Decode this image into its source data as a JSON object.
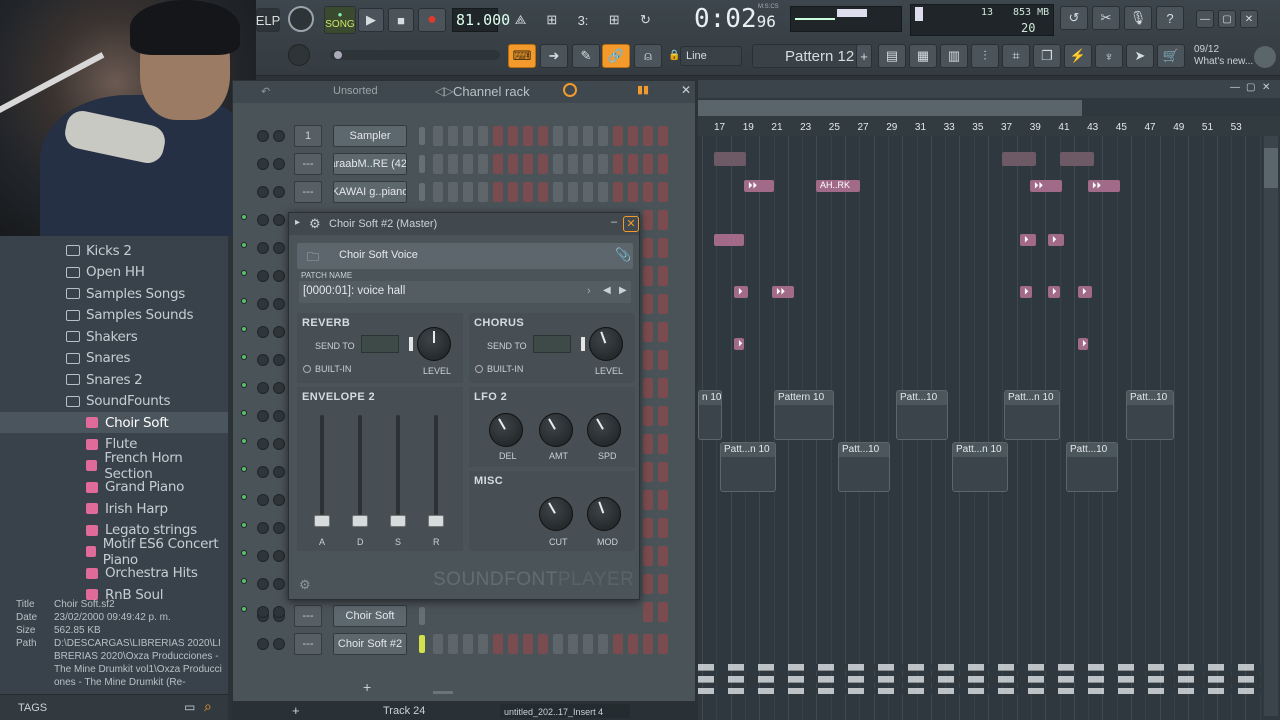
{
  "toolbar": {
    "elp": "ELP",
    "song": "SONG",
    "bpm": "81.000",
    "time": "0:02",
    "time_sub": "96",
    "time_unit": "M:S:CS",
    "cpu_num": "13",
    "mem": "853 MB",
    "voices": "20",
    "snap": "Line",
    "pattern": "Pattern 12",
    "news_date": "09/12",
    "news_text": "What's new..."
  },
  "rack": {
    "filter": "Unsorted",
    "title": "Channel rack",
    "channels": [
      {
        "num": "1",
        "name": "Sampler"
      },
      {
        "num": "---",
        "name": "araabM..RE (42)"
      },
      {
        "num": "---",
        "name": "KAWAI g..piano"
      },
      {
        "num": "---",
        "name": "Choir Soft"
      },
      {
        "num": "---",
        "name": "Choir Soft #2"
      }
    ],
    "add": "+"
  },
  "sfp": {
    "title": "Choir Soft #2 (Master)",
    "preset": "Choir Soft Voice",
    "patch_label": "PATCH NAME",
    "patch": "[0000:01]: voice hall",
    "reverb": "REVERB",
    "chorus": "CHORUS",
    "send_to": "SEND TO",
    "built_in": "BUILT-IN",
    "level": "LEVEL",
    "env": "ENVELOPE 2",
    "lfo": "LFO 2",
    "misc": "MISC",
    "env_labels": [
      "A",
      "D",
      "S",
      "R"
    ],
    "lfo_labels": [
      "DEL",
      "AMT",
      "SPD"
    ],
    "misc_labels": [
      "CUT",
      "MOD"
    ],
    "brand": "SOUNDFONT",
    "brand2": "PLAYER"
  },
  "browser": {
    "items": [
      {
        "label": "Kicks 2",
        "type": "folder",
        "indent": 0
      },
      {
        "label": "Open HH",
        "type": "folder",
        "indent": 0
      },
      {
        "label": "Samples Songs",
        "type": "folder",
        "indent": 0
      },
      {
        "label": "Samples Sounds",
        "type": "folder",
        "indent": 0
      },
      {
        "label": "Shakers",
        "type": "folder",
        "indent": 0
      },
      {
        "label": "Snares",
        "type": "folder",
        "indent": 0
      },
      {
        "label": "Snares 2",
        "type": "folder",
        "indent": 0
      },
      {
        "label": "SoundFounts",
        "type": "folder-open",
        "indent": 0
      },
      {
        "label": "Choir Soft",
        "type": "sf",
        "indent": 1
      },
      {
        "label": "Flute",
        "type": "sf",
        "indent": 1
      },
      {
        "label": "French Horn Section",
        "type": "sf",
        "indent": 1
      },
      {
        "label": "Grand Piano",
        "type": "sf",
        "indent": 1
      },
      {
        "label": "Irish Harp",
        "type": "sf",
        "indent": 1
      },
      {
        "label": "Legato strings",
        "type": "sf",
        "indent": 1
      },
      {
        "label": "Motif ES6 Concert Piano",
        "type": "sf",
        "indent": 1
      },
      {
        "label": "Orchestra Hits",
        "type": "sf",
        "indent": 1
      },
      {
        "label": "RnB Soul",
        "type": "sf",
        "indent": 1
      }
    ],
    "info": {
      "title_k": "Title",
      "title_v": "Choir Soft.sf2",
      "date_k": "Date",
      "date_v": "23/02/2000 09:49:42 p. m.",
      "size_k": "Size",
      "size_v": "562.85 KB",
      "path_k": "Path",
      "path_v": "D:\\DESCARGAS\\LIBRERIAS 2020\\LIBRERIAS 2020\\Oxza Producciones - The Mine Drumkit vol1\\Oxza Producciones - The Mine Drumkit (Re-"
    },
    "tags": "TAGS"
  },
  "playlist": {
    "ruler": [
      "17",
      "19",
      "21",
      "23",
      "25",
      "27",
      "29",
      "31",
      "33",
      "35",
      "37",
      "39",
      "41",
      "43",
      "45",
      "47",
      "49",
      "51",
      "53"
    ],
    "patterns": [
      "n 10",
      "Pattern 10",
      "Patt...10",
      "Patt...n 10",
      "Patt...10",
      "Patt...n 10",
      "Patt...10",
      "Patt...n 10",
      "Patt...10"
    ],
    "clip_label": "AH..RK"
  },
  "status": {
    "track": "Track 24",
    "file": "untitled_202..17_Insert 4",
    "plus": "+"
  }
}
